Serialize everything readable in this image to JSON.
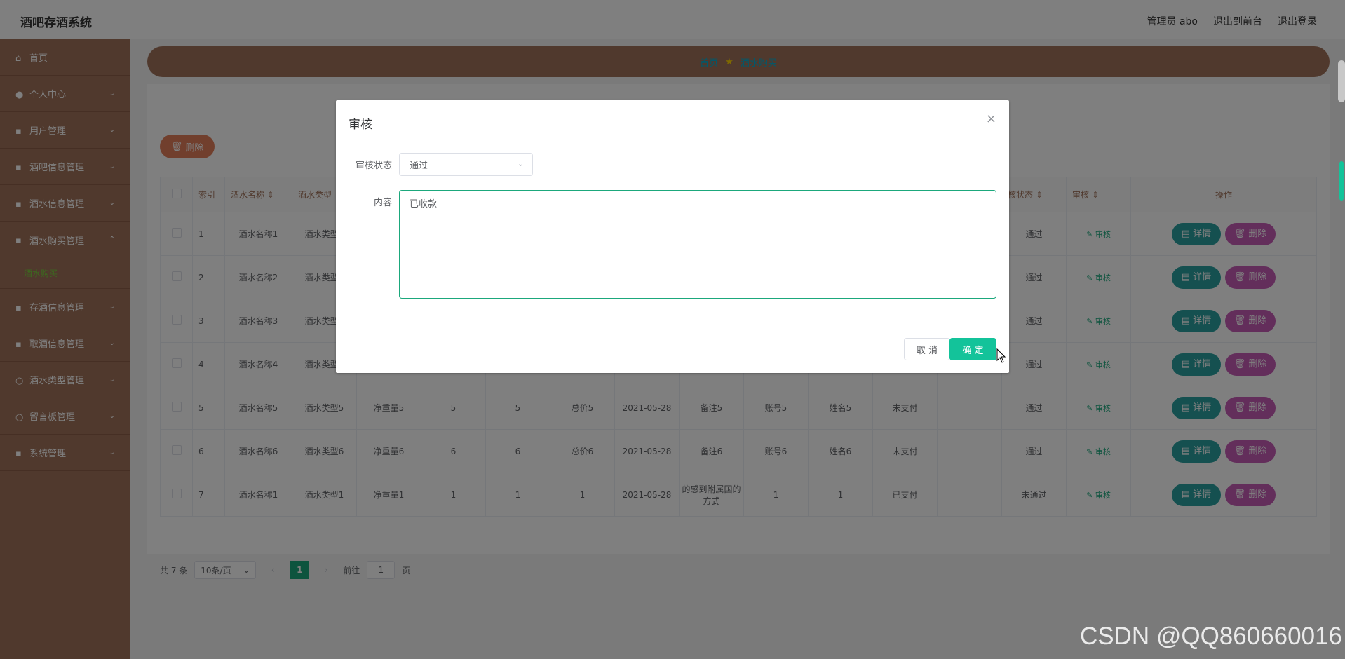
{
  "header": {
    "app_title": "酒吧存酒系统",
    "admin": "管理员 abo",
    "back_front": "退出到前台",
    "logout": "退出登录"
  },
  "sidebar": {
    "items": [
      {
        "label": "首页"
      },
      {
        "label": "个人中心"
      },
      {
        "label": "用户管理"
      },
      {
        "label": "酒吧信息管理"
      },
      {
        "label": "酒水信息管理"
      },
      {
        "label": "酒水购买管理"
      },
      {
        "label": "存酒信息管理"
      },
      {
        "label": "取酒信息管理"
      },
      {
        "label": "酒水类型管理"
      },
      {
        "label": "留言板管理"
      },
      {
        "label": "系统管理"
      }
    ],
    "sub_active": "酒水购买"
  },
  "breadcrumb": {
    "home": "首页",
    "current": "酒水购买"
  },
  "toolbar": {
    "delete": "删除"
  },
  "table": {
    "headers": [
      "索引",
      "酒水名称",
      "酒水类型",
      "核状态",
      "审核",
      "操作"
    ],
    "rows": [
      {
        "idx": "1",
        "name": "酒水名称1",
        "type": "酒水类型1",
        "net": "",
        "qty": "",
        "price": "",
        "total": "",
        "date": "",
        "remark": "",
        "account": "",
        "uname": "",
        "pay": "",
        "status": "通过"
      },
      {
        "idx": "2",
        "name": "酒水名称2",
        "type": "酒水类型2",
        "net": "",
        "qty": "",
        "price": "",
        "total": "",
        "date": "",
        "remark": "",
        "account": "",
        "uname": "",
        "pay": "",
        "status": "通过"
      },
      {
        "idx": "3",
        "name": "酒水名称3",
        "type": "酒水类型3",
        "net": "",
        "qty": "",
        "price": "",
        "total": "",
        "date": "",
        "remark": "",
        "account": "",
        "uname": "",
        "pay": "",
        "status": "通过"
      },
      {
        "idx": "4",
        "name": "酒水名称4",
        "type": "酒水类型4",
        "net": "",
        "qty": "",
        "price": "",
        "total": "",
        "date": "",
        "remark": "",
        "account": "",
        "uname": "",
        "pay": "",
        "status": "通过"
      },
      {
        "idx": "5",
        "name": "酒水名称5",
        "type": "酒水类型5",
        "net": "净重量5",
        "qty": "5",
        "price": "5",
        "total": "总价5",
        "date": "2021-05-28",
        "remark": "备注5",
        "account": "账号5",
        "uname": "姓名5",
        "pay": "未支付",
        "status": "通过"
      },
      {
        "idx": "6",
        "name": "酒水名称6",
        "type": "酒水类型6",
        "net": "净重量6",
        "qty": "6",
        "price": "6",
        "total": "总价6",
        "date": "2021-05-28",
        "remark": "备注6",
        "account": "账号6",
        "uname": "姓名6",
        "pay": "未支付",
        "status": "通过"
      },
      {
        "idx": "7",
        "name": "酒水名称1",
        "type": "酒水类型1",
        "net": "净重量1",
        "qty": "1",
        "price": "1",
        "total": "1",
        "date": "2021-05-28",
        "remark": "的感到附属国的方式",
        "account": "1",
        "uname": "1",
        "pay": "已支付",
        "status": "未通过"
      }
    ],
    "audit_label": "审核",
    "detail_label": "详情",
    "delete_label": "删除"
  },
  "pager": {
    "total": "共 7 条",
    "page_size": "10条/页",
    "current": "1",
    "goto_prefix": "前往",
    "goto_value": "1",
    "goto_suffix": "页"
  },
  "dialog": {
    "title": "审核",
    "status_label": "审核状态",
    "status_value": "通过",
    "content_label": "内容",
    "content_value": "已收款",
    "cancel": "取 消",
    "ok": "确 定"
  },
  "watermark": "CSDN @QQ860660016"
}
